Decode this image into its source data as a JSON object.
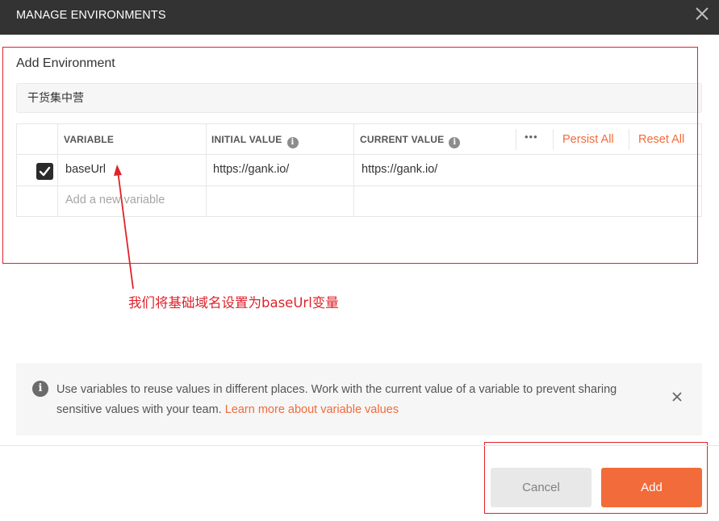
{
  "window": {
    "title": "MANAGE ENVIRONMENTS",
    "close_icon": "close-icon"
  },
  "environment": {
    "heading": "Add Environment",
    "name_value": "干货集中营"
  },
  "table": {
    "headers": {
      "variable": "VARIABLE",
      "initial": "INITIAL VALUE",
      "current": "CURRENT VALUE"
    },
    "info_glyph": "i",
    "more_glyph": "•••",
    "persist_all": "Persist All",
    "reset_all": "Reset All",
    "rows": [
      {
        "checked": true,
        "variable": "baseUrl",
        "initial": "https://gank.io/",
        "current": "https://gank.io/"
      }
    ],
    "new_row_placeholder": "Add a new variable"
  },
  "annotation": {
    "text": "我们将基础域名设置为baseUrl变量",
    "color": "#e0222a"
  },
  "notice": {
    "info_glyph": "i",
    "message": "Use variables to reuse values in different places. Work with the current value of a variable to prevent sharing sensitive values with your team.",
    "link": "Learn more about variable values"
  },
  "footer": {
    "cancel_label": "Cancel",
    "add_label": "Add"
  },
  "colors": {
    "accent": "#f26b3a",
    "titlebar": "#333333",
    "annotation": "#e0222a"
  }
}
